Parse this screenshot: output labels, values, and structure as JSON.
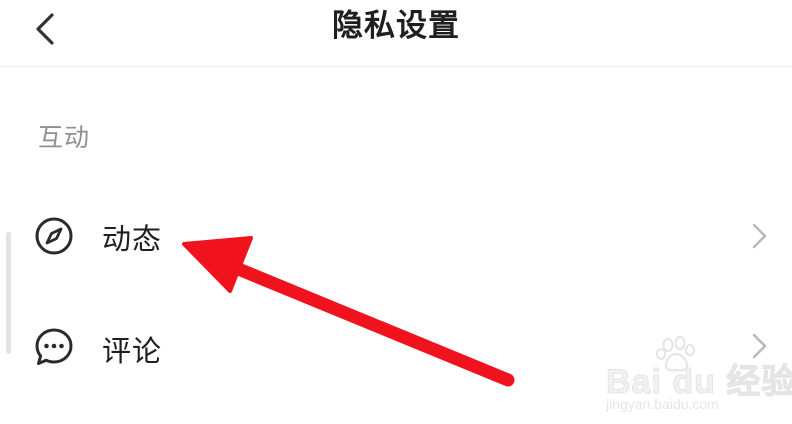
{
  "header": {
    "title": "隐私设置",
    "back_icon": "chevron-left-icon"
  },
  "section": {
    "label": "互动"
  },
  "rows": [
    {
      "label": "动态",
      "icon": "compass-icon",
      "chevron": "chevron-right-icon"
    },
    {
      "label": "评论",
      "icon": "speech-bubble-icon",
      "chevron": "chevron-right-icon"
    }
  ],
  "annotation": {
    "arrow_color": "#f0131e"
  },
  "watermark": {
    "brand": "Bai du 经验",
    "url": "jingyan.baidu.com"
  }
}
